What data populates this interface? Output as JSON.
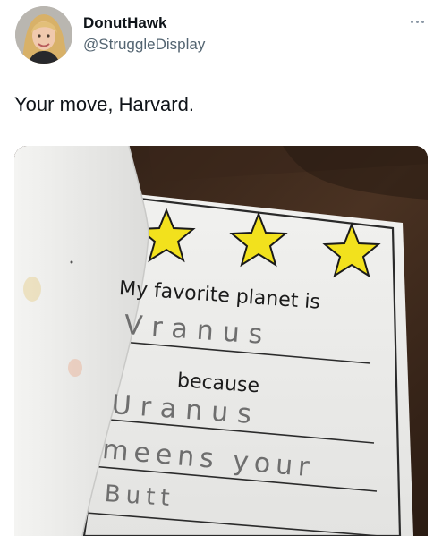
{
  "tweet": {
    "display_name": "DonutHawk",
    "handle": "@StruggleDisplay",
    "text": "Your move, Harvard.",
    "more_icon": "more-horizontal-icon"
  },
  "worksheet": {
    "prompt": "My favorite planet is",
    "answer_planet": "Vranus",
    "connector": "because",
    "reason_line_1": "Uranus",
    "reason_line_2": "meens your",
    "reason_line_3": "Butt",
    "star_color": "#f2e11d"
  }
}
